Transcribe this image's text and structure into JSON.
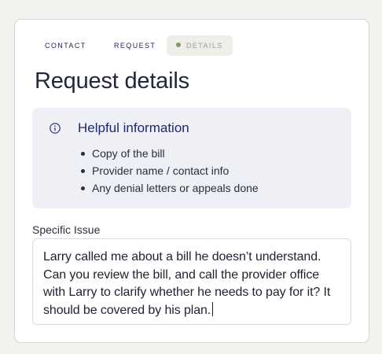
{
  "steps": [
    {
      "label": "CONTACT"
    },
    {
      "label": "REQUEST"
    },
    {
      "label": "DETAILS",
      "active": true
    }
  ],
  "page": {
    "title": "Request details"
  },
  "info": {
    "icon": "info-circle-icon",
    "heading": "Helpful information",
    "items": [
      "Copy of the bill",
      "Provider name / contact info",
      "Any denial letters or appeals done"
    ]
  },
  "issue": {
    "label": "Specific Issue",
    "value": "Larry called me about a bill he doesn’t understand. Can you review the bill, and call the provider office with Larry to clarify whether he needs to pay for it? It should be covered by his plan."
  },
  "colors": {
    "accent": "#202673",
    "active_dot": "#7e9b6a",
    "info_bg": "#eef0f5",
    "page_bg": "#f4f2ee"
  }
}
